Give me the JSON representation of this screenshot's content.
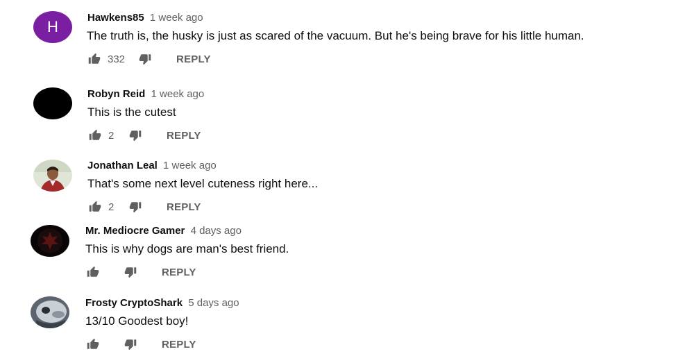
{
  "comments": [
    {
      "avatar_letter": "H",
      "author": "Hawkens85",
      "time": "1 week ago",
      "text": "The truth is, the husky is just as scared of the vacuum. But he's being brave for his little human.",
      "likes": "332",
      "reply_label": "REPLY"
    },
    {
      "author": "Robyn Reid",
      "time": "1 week ago",
      "text": "This is the cutest",
      "likes": "2",
      "reply_label": "REPLY"
    },
    {
      "author": "Jonathan Leal",
      "time": "1 week ago",
      "text": "That's some next level cuteness right here...",
      "likes": "2",
      "reply_label": "REPLY"
    },
    {
      "author": "Mr. Mediocre Gamer",
      "time": "4 days ago",
      "text": "This is why dogs are man's best friend.",
      "likes": "",
      "reply_label": "REPLY"
    },
    {
      "author": "Frosty CryptoShark",
      "time": "5 days ago",
      "text": "13/10  Goodest boy!",
      "likes": "",
      "reply_label": "REPLY"
    }
  ],
  "colors": {
    "avatar_purple": "#7b1fa2",
    "text_primary": "#0f0f0f",
    "text_secondary": "#606060"
  },
  "icons": {
    "like": "thumb-up-icon",
    "dislike": "thumb-down-icon"
  }
}
